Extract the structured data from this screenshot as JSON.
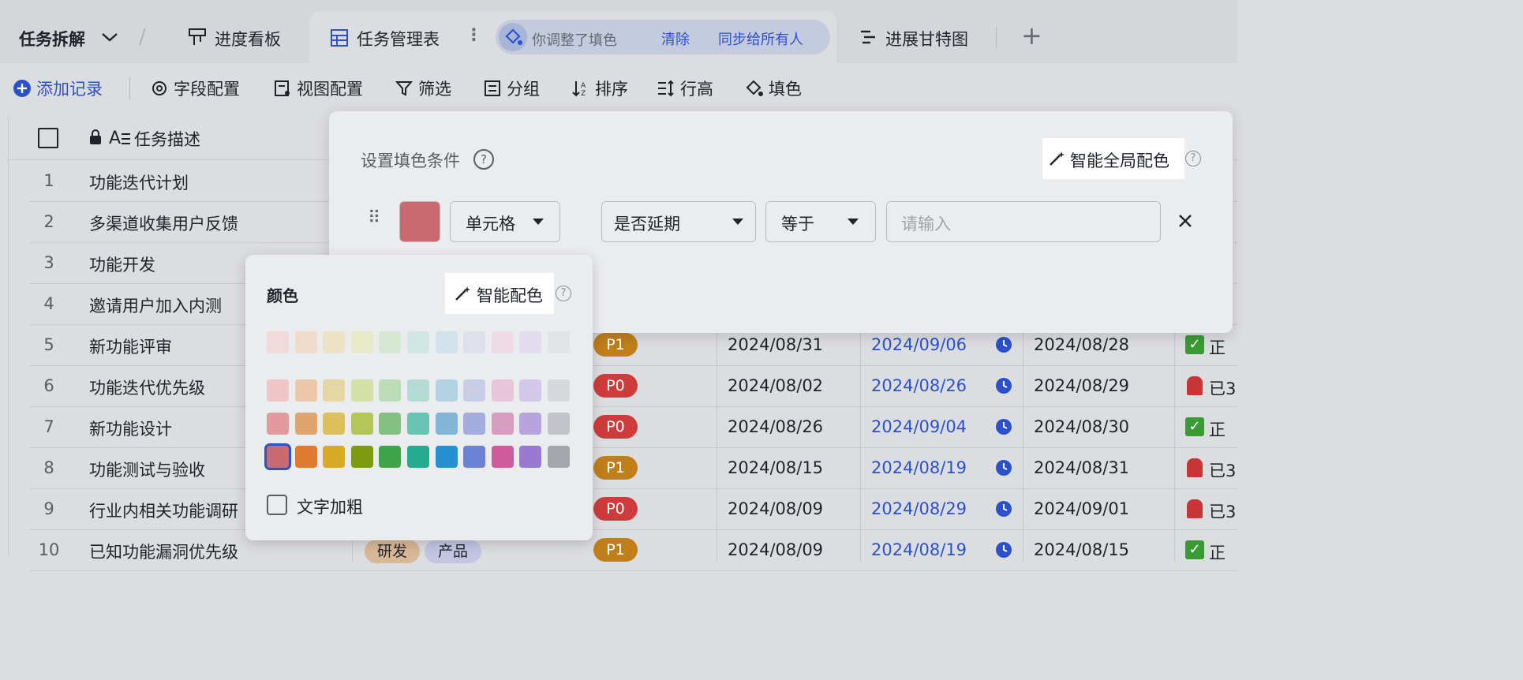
{
  "tabs": {
    "breadcrumb": "任务拆解",
    "kanban": "进度看板",
    "table": "任务管理表",
    "gantt": "进展甘特图"
  },
  "notice": {
    "text": "你调整了填色",
    "clear": "清除",
    "sync": "同步给所有人"
  },
  "toolbar": {
    "add": "添加记录",
    "fields": "字段配置",
    "view": "视图配置",
    "filter": "筛选",
    "group": "分组",
    "sort": "排序",
    "row_height": "行高",
    "fill": "填色"
  },
  "table": {
    "header_desc": "任务描述",
    "rows": [
      {
        "n": "1",
        "desc": "功能迭代计划"
      },
      {
        "n": "2",
        "desc": "多渠道收集用户反馈"
      },
      {
        "n": "3",
        "desc": "功能开发"
      },
      {
        "n": "4",
        "desc": "邀请用户加入内测"
      },
      {
        "n": "5",
        "desc": "新功能评审",
        "pri": "P1",
        "start": "2024/08/31",
        "due": "2024/09/06",
        "done": "2024/08/28",
        "status": "正"
      },
      {
        "n": "6",
        "desc": "功能迭代优先级",
        "pri": "P0",
        "start": "2024/08/02",
        "due": "2024/08/26",
        "done": "2024/08/29",
        "status": "已3"
      },
      {
        "n": "7",
        "desc": "新功能设计",
        "pri": "P0",
        "start": "2024/08/26",
        "due": "2024/09/04",
        "done": "2024/08/30",
        "status": "正"
      },
      {
        "n": "8",
        "desc": "功能测试与验收",
        "pri": "P1",
        "start": "2024/08/15",
        "due": "2024/08/19",
        "done": "2024/08/31",
        "status": "已3"
      },
      {
        "n": "9",
        "desc": "行业内相关功能调研",
        "pri": "P0",
        "start": "2024/08/09",
        "due": "2024/08/29",
        "done": "2024/09/01",
        "status": "已3"
      },
      {
        "n": "10",
        "desc": "已知功能漏洞优先级",
        "tag1": "研发",
        "tag2": "产品",
        "pri": "P1",
        "start": "2024/08/09",
        "due": "2024/08/19",
        "done": "2024/08/15",
        "status": "正"
      }
    ]
  },
  "panel": {
    "title": "设置填色条件",
    "smart_global": "智能全局配色",
    "scope": "单元格",
    "field": "是否延期",
    "op": "等于",
    "value_placeholder": "请输入"
  },
  "popup": {
    "title": "颜色",
    "smart": "智能配色",
    "bold": "文字加粗",
    "row1": [
      "#f1d9dc",
      "#efdccb",
      "#ece3c6",
      "#e6eac8",
      "#d6e8d2",
      "#d1e7e2",
      "#d2e2ea",
      "#dfe0ec",
      "#eedbe6",
      "#e2dcee",
      "#e3e4e6"
    ],
    "row2": [
      "#efc5c8",
      "#ecc8a8",
      "#e6d7a2",
      "#d5e0a4",
      "#bcdcb5",
      "#b4dcd4",
      "#b5d2e4",
      "#c9cde8",
      "#e8c6da",
      "#d3c8ea",
      "#d7d8dc"
    ],
    "row3": [
      "#e19a9e",
      "#e0a56f",
      "#dcc05b",
      "#b4c65a",
      "#84c083",
      "#6ac4b4",
      "#81b6d6",
      "#a4addf",
      "#d89cc0",
      "#b8a3df",
      "#c3c5ca"
    ],
    "row4": [
      "#c96b6e",
      "#e07a2f",
      "#d9a928",
      "#7e9a12",
      "#3ea447",
      "#26ab90",
      "#2591d0",
      "#6c83d5",
      "#cf5b9c",
      "#9a79d2",
      "#a4a6ab"
    ]
  },
  "colors": {
    "accent": "#2b52c9",
    "p1": "#c17f1c",
    "p0": "#cf3b3b",
    "selected": "#c96b6e"
  }
}
